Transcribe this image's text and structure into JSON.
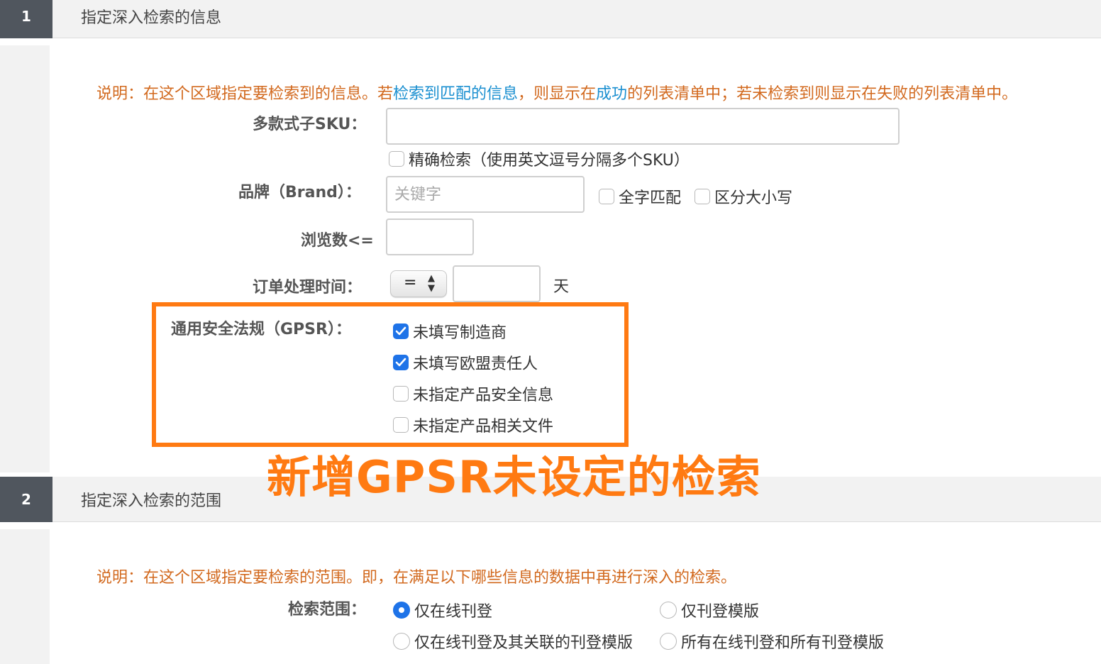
{
  "section1": {
    "number": "1",
    "title": "指定深入检索的信息",
    "note_prefix": "说明：在这个区域指定要检索到的信息。若",
    "note_link1": "检索到匹配的信息",
    "note_mid": "，则显示在",
    "note_link2": "成功",
    "note_suffix": "的列表清单中；若未检索到则显示在失败的列表清单中。",
    "sku_label": "多款式子SKU：",
    "sku_value": "",
    "exact_search_label": "精确检索（使用英文逗号分隔多个SKU）",
    "exact_search_checked": false,
    "brand_label": "品牌（Brand）：",
    "brand_placeholder": "关键字",
    "full_match_label": "全字匹配",
    "full_match_checked": false,
    "case_sensitive_label": "区分大小写",
    "case_sensitive_checked": false,
    "views_label": "浏览数<=",
    "views_value": "",
    "handling_time_label": "订单处理时间：",
    "handling_operator": "=",
    "handling_value": "",
    "handling_unit": "天",
    "gpsr_label": "通用安全法规（GPSR）：",
    "gpsr_options": [
      {
        "label": "未填写制造商",
        "checked": true
      },
      {
        "label": "未填写欧盟责任人",
        "checked": true
      },
      {
        "label": "未指定产品安全信息",
        "checked": false
      },
      {
        "label": "未指定产品相关文件",
        "checked": false
      }
    ]
  },
  "annotation_text": "新增GPSR未设定的检索",
  "section2": {
    "number": "2",
    "title": "指定深入检索的范围",
    "note": "说明：在这个区域指定要检索的范围。即，在满足以下哪些信息的数据中再进行深入的检索。",
    "scope_label": "检索范围：",
    "scope_options": [
      {
        "label": "仅在线刊登",
        "selected": true
      },
      {
        "label": "仅刊登模版",
        "selected": false
      },
      {
        "label": "仅在线刊登及其关联的刊登模版",
        "selected": false
      },
      {
        "label": "所有在线刊登和所有刊登模版",
        "selected": false
      }
    ]
  },
  "colors": {
    "accent_orange": "#ff7a12",
    "note_orange": "#d2691e",
    "link_blue": "#1a8fd0",
    "check_blue": "#1e73e8"
  }
}
